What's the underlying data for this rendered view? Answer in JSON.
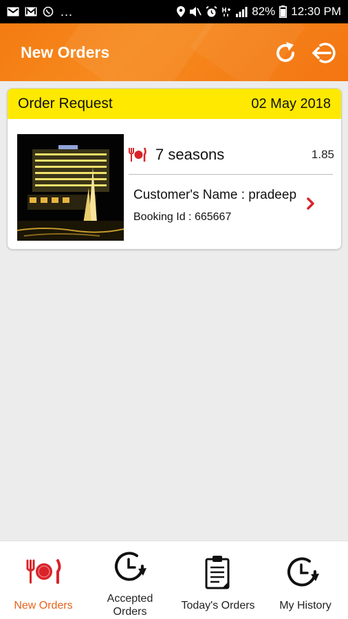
{
  "status_bar": {
    "dots": "...",
    "battery": "82%",
    "time": "12:30 PM"
  },
  "app_bar": {
    "title": "New Orders",
    "refresh_icon": "refresh-icon",
    "logout_icon": "logout-icon"
  },
  "order_card": {
    "header_title": "Order Request",
    "date": "02 May 2018",
    "restaurant_name": "7 seasons",
    "distance": "1.85",
    "customer_name": "Customer's Name : pradeep",
    "booking_id": "Booking Id : 665667"
  },
  "bottom_nav": {
    "items": [
      {
        "label": "New Orders",
        "icon": "plate-cutlery-icon",
        "active": true
      },
      {
        "label_line1": "Accepted",
        "label_line2": "Orders",
        "icon": "clock-refresh-icon",
        "active": false
      },
      {
        "label": "Today's Orders",
        "icon": "clipboard-icon",
        "active": false
      },
      {
        "label": "My History",
        "icon": "history-clock-icon",
        "active": false
      }
    ]
  },
  "colors": {
    "app_bar": "#f47b12",
    "card_header": "#ffe900",
    "accent_red": "#d9232a",
    "active_tab": "#e8621a"
  }
}
